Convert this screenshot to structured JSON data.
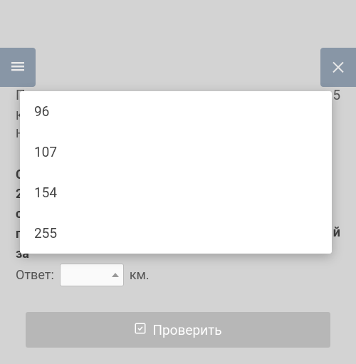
{
  "topbar": {
    "menu_icon": "menu",
    "close_icon": "close"
  },
  "question": {
    "title_fragment_left": "П",
    "title_fragment_right": "5",
    "subtitle_line1": "К",
    "subtitle_line2": "Н",
    "bold_line1": "С",
    "bold_line2": "20",
    "bold_line3": "со",
    "bold_line4": "п",
    "bold_line5": "за",
    "bold_right": "й"
  },
  "answer": {
    "label": "Ответ:",
    "unit": "км."
  },
  "button": {
    "check_label": "Проверить"
  },
  "dropdown": {
    "options": [
      "96",
      "107",
      "154",
      "255"
    ]
  }
}
